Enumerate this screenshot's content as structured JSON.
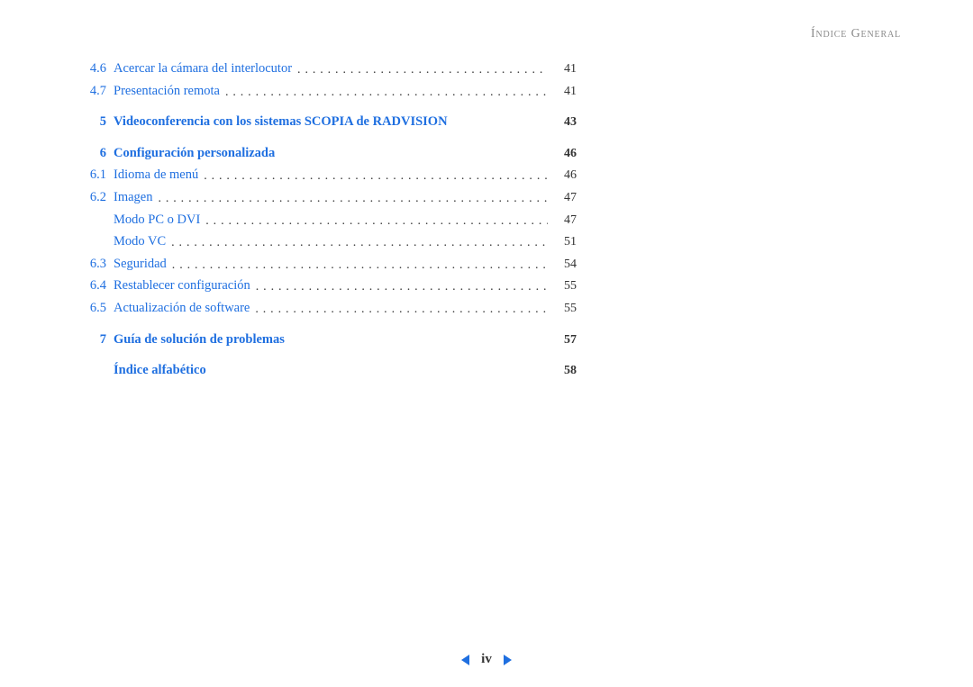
{
  "header": {
    "title": "Índice General"
  },
  "link_color": "#1f6fe0",
  "toc": {
    "items": [
      {
        "num": "4.6",
        "title": "Acercar la cámara del interlocutor",
        "page": "41",
        "level": 1,
        "bold": false,
        "leader": true
      },
      {
        "num": "4.7",
        "title": "Presentación remota",
        "page": "41",
        "level": 1,
        "bold": false,
        "leader": true
      },
      {
        "num": "5",
        "title": "Videoconferencia con los sistemas SCOPIA de RADVISION",
        "page": "43",
        "level": 0,
        "bold": true,
        "leader": false,
        "gap": true
      },
      {
        "num": "6",
        "title": "Configuración personalizada",
        "page": "46",
        "level": 0,
        "bold": true,
        "leader": false,
        "gap": true
      },
      {
        "num": "6.1",
        "title": "Idioma de menú",
        "page": "46",
        "level": 1,
        "bold": false,
        "leader": true
      },
      {
        "num": "6.2",
        "title": "Imagen",
        "page": "47",
        "level": 1,
        "bold": false,
        "leader": true
      },
      {
        "num": "",
        "title": "Modo PC o DVI",
        "page": "47",
        "level": 2,
        "bold": false,
        "leader": true
      },
      {
        "num": "",
        "title": "Modo VC",
        "page": "51",
        "level": 2,
        "bold": false,
        "leader": true
      },
      {
        "num": "6.3",
        "title": "Seguridad",
        "page": "54",
        "level": 1,
        "bold": false,
        "leader": true
      },
      {
        "num": "6.4",
        "title": "Restablecer configuración",
        "page": "55",
        "level": 1,
        "bold": false,
        "leader": true
      },
      {
        "num": "6.5",
        "title": "Actualización de software",
        "page": "55",
        "level": 1,
        "bold": false,
        "leader": true
      },
      {
        "num": "7",
        "title": "Guía de solución de problemas",
        "page": "57",
        "level": 0,
        "bold": true,
        "leader": false,
        "gap": true
      },
      {
        "num": "",
        "title": "Índice alfabético",
        "page": "58",
        "level": 0,
        "bold": true,
        "leader": false,
        "gap": true
      }
    ]
  },
  "footer": {
    "page_number": "iv",
    "prev_icon": "triangle-left",
    "next_icon": "triangle-right",
    "arrow_color": "#1f6fe0"
  }
}
